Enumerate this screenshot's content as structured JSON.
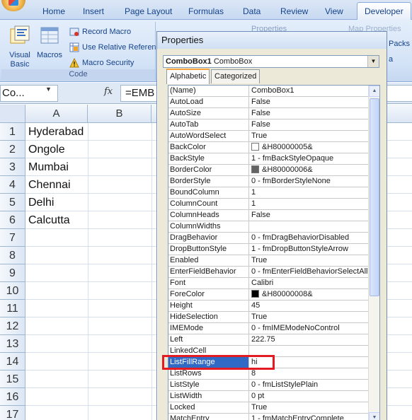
{
  "ribbon": {
    "tabs": [
      "Home",
      "Insert",
      "Page Layout",
      "Formulas",
      "Data",
      "Review",
      "View",
      "Developer"
    ],
    "active_tab": "Developer",
    "code_group": {
      "label": "Code",
      "visual_basic": "Visual Basic",
      "macros": "Macros",
      "record_macro": "Record Macro",
      "relative_references": "Use Relative Reference",
      "macro_security": "Macro Security"
    },
    "partial_properties": "Properties",
    "partial_map_properties": "Map Properties",
    "partial_packs": "Packs",
    "partial_a": "a"
  },
  "formula_bar": {
    "name_box": "Co...",
    "fx_label": "fx",
    "formula": "=EMB"
  },
  "sheet": {
    "columns": [
      "A",
      "B"
    ],
    "rows": [
      "1",
      "2",
      "3",
      "4",
      "5",
      "6",
      "7",
      "8",
      "9",
      "10",
      "11",
      "12",
      "13",
      "14",
      "15",
      "16",
      "17"
    ],
    "cells_a": [
      "Hyderabad",
      "Ongole",
      "Mumbai",
      "Chennai",
      "Delhi",
      "Calcutta"
    ]
  },
  "properties_window": {
    "title": "Properties",
    "object_name": "ComboBox1",
    "object_type": "ComboBox",
    "tabs": [
      "Alphabetic",
      "Categorized"
    ],
    "active_tab": "Alphabetic",
    "selected_property": "ListFillRange",
    "rows": [
      {
        "name": "(Name)",
        "value": "ComboBox1"
      },
      {
        "name": "AutoLoad",
        "value": "False"
      },
      {
        "name": "AutoSize",
        "value": "False"
      },
      {
        "name": "AutoTab",
        "value": "False"
      },
      {
        "name": "AutoWordSelect",
        "value": "True"
      },
      {
        "name": "BackColor",
        "value": "&H80000005&",
        "swatch": "#ffffff"
      },
      {
        "name": "BackStyle",
        "value": "1 - fmBackStyleOpaque"
      },
      {
        "name": "BorderColor",
        "value": "&H80000006&",
        "swatch": "#646464"
      },
      {
        "name": "BorderStyle",
        "value": "0 - fmBorderStyleNone"
      },
      {
        "name": "BoundColumn",
        "value": "1"
      },
      {
        "name": "ColumnCount",
        "value": "1"
      },
      {
        "name": "ColumnHeads",
        "value": "False"
      },
      {
        "name": "ColumnWidths",
        "value": ""
      },
      {
        "name": "DragBehavior",
        "value": "0 - fmDragBehaviorDisabled"
      },
      {
        "name": "DropButtonStyle",
        "value": "1 - fmDropButtonStyleArrow"
      },
      {
        "name": "Enabled",
        "value": "True"
      },
      {
        "name": "EnterFieldBehavior",
        "value": "0 - fmEnterFieldBehaviorSelectAll"
      },
      {
        "name": "Font",
        "value": "Calibri"
      },
      {
        "name": "ForeColor",
        "value": "&H80000008&",
        "swatch": "#000000"
      },
      {
        "name": "Height",
        "value": "45"
      },
      {
        "name": "HideSelection",
        "value": "True"
      },
      {
        "name": "IMEMode",
        "value": "0 - fmIMEModeNoControl"
      },
      {
        "name": "Left",
        "value": "222.75"
      },
      {
        "name": "LinkedCell",
        "value": ""
      },
      {
        "name": "ListFillRange",
        "value": "hi"
      },
      {
        "name": "ListRows",
        "value": "8"
      },
      {
        "name": "ListStyle",
        "value": "0 - fmListStylePlain"
      },
      {
        "name": "ListWidth",
        "value": "0 pt"
      },
      {
        "name": "Locked",
        "value": "True"
      },
      {
        "name": "MatchEntry",
        "value": "1 - fmMatchEntryComplete"
      }
    ]
  },
  "colors": {
    "selection": "#316ac5",
    "highlight_box": "#e31b23"
  }
}
